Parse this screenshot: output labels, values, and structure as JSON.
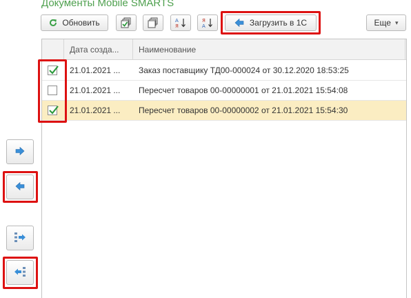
{
  "form": {
    "title": "Документы Mobile SMARTS"
  },
  "toolbar": {
    "refresh_label": "Обновить",
    "load_label": "Загрузить в 1С",
    "more_label": "Еще",
    "more_chevron": "▾"
  },
  "icons": {
    "refresh": "refresh-icon",
    "check_all": "check-all-icon",
    "uncheck_all": "uncheck-all-icon",
    "sort_asc": "sort-ascending-icon",
    "sort_desc": "sort-descending-icon",
    "load_arrow": "arrow-left-icon",
    "move_right": "arrow-right-icon",
    "move_left": "arrow-left-icon",
    "tree_right": "tree-move-right-icon",
    "tree_left": "tree-move-left-icon"
  },
  "colors": {
    "title": "#4ea04e",
    "highlight_box": "#dd1111",
    "selected_row": "#fbedc2",
    "check": "#2e9a3e",
    "arrow": "#3a8fd8"
  },
  "table": {
    "columns": [
      "Дата созда...",
      "Наименование"
    ],
    "rows": [
      {
        "checked": true,
        "date": "21.01.2021 ...",
        "name": "Заказ поставщику ТД00-000024 от 30.12.2020 18:53:25",
        "selected": false
      },
      {
        "checked": false,
        "date": "21.01.2021 ...",
        "name": "Пересчет товаров 00-00000001 от 21.01.2021 15:54:08",
        "selected": false
      },
      {
        "checked": true,
        "date": "21.01.2021 ...",
        "name": "Пересчет товаров 00-00000002 от 21.01.2021 15:54:30",
        "selected": true
      }
    ]
  }
}
